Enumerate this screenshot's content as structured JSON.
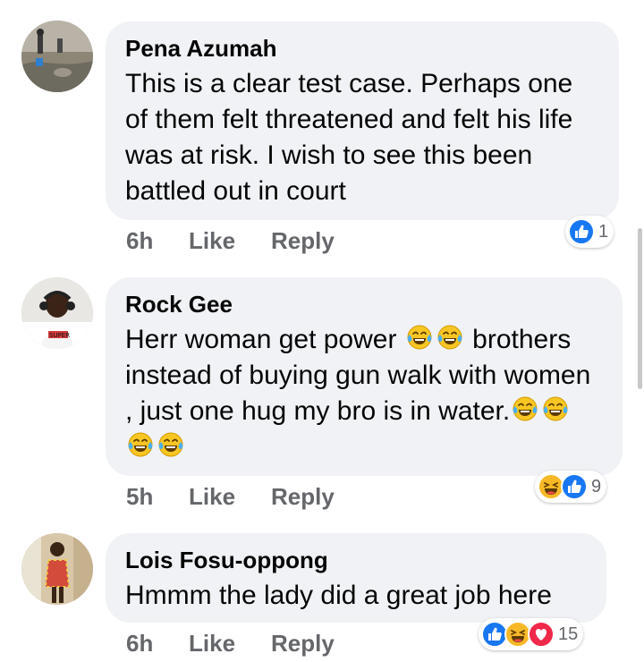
{
  "comments": [
    {
      "author": "Pena Azumah",
      "text": "This is a clear test case. Perhaps one of them felt threatened and felt his life was at risk. I wish to see this been battled out in court",
      "time": "6h",
      "like_label": "Like",
      "reply_label": "Reply",
      "reactions": [
        "like-icon"
      ],
      "reaction_count": "1"
    },
    {
      "author": "Rock Gee",
      "text_parts": [
        "Herr woman get power",
        "brothers instead of buying gun walk with women , just one hug my bro is in water."
      ],
      "text_emojis": [
        "tears-of-joy-emoji",
        "tears-of-joy-emoji",
        "tears-of-joy-emoji",
        "tears-of-joy-emoji",
        "tears-of-joy-emoji",
        "tears-of-joy-emoji"
      ],
      "time": "5h",
      "like_label": "Like",
      "reply_label": "Reply",
      "reactions": [
        "haha-icon",
        "like-icon"
      ],
      "reaction_count": "9"
    },
    {
      "author": "Lois Fosu-oppong",
      "text": "Hmmm the lady did a great job here",
      "time": "6h",
      "like_label": "Like",
      "reply_label": "Reply",
      "reactions": [
        "like-icon",
        "haha-icon",
        "love-icon"
      ],
      "reaction_count": "15"
    }
  ],
  "colors": {
    "bubble": "#f0f2f5",
    "meta_text": "#65676b",
    "like_blue": "#1877f2",
    "love_red": "#f02849",
    "haha_yellow": "#f7b928"
  }
}
